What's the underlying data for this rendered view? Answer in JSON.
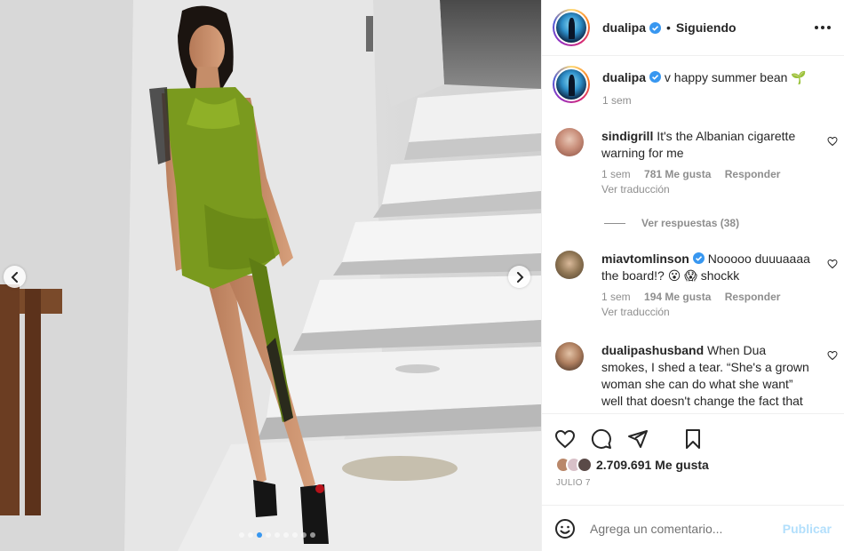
{
  "post": {
    "username": "dualipa",
    "follow_status": "Siguiendo",
    "bullet": "•",
    "caption": "v happy summer bean 🌱",
    "caption_time": "1 sem",
    "likes": "2.709.691 Me gusta",
    "date": "JULIO 7",
    "carousel_dots": 9,
    "carousel_active": 2
  },
  "comments": [
    {
      "username": "sindigrill",
      "text": "It's the Albanian cigarette warning for me",
      "time": "1 sem",
      "likes": "781 Me gusta",
      "reply": "Responder",
      "translate": "Ver traducción",
      "view_replies": "Ver respuestas (38)"
    },
    {
      "username": "miavtomlinson",
      "verified": true,
      "text": "Nooooo duuuaaaa the board!? 😮 😱  shockk",
      "time": "1 sem",
      "likes": "194 Me gusta",
      "reply": "Responder",
      "translate": "Ver traducción"
    },
    {
      "username": "dualipashusband",
      "text": "When Dua smokes, I shed a tear. “She's a grown woman she can do what she want” well that doesn't change the fact that she's getting ill well"
    }
  ],
  "comment_input": {
    "placeholder": "Agrega un comentario...",
    "publish": "Publicar"
  },
  "icons": [
    "emoji-icon",
    "heart-icon",
    "comment-icon",
    "share-icon",
    "bookmark-icon",
    "more-icon",
    "chevron-left-icon",
    "chevron-right-icon",
    "verified-icon"
  ],
  "colors": {
    "accent_blue": "#3897f0",
    "publish_disabled": "#b2dffc",
    "secondary_text": "#8e8e8e",
    "dress_green": "#7a9a1e"
  }
}
